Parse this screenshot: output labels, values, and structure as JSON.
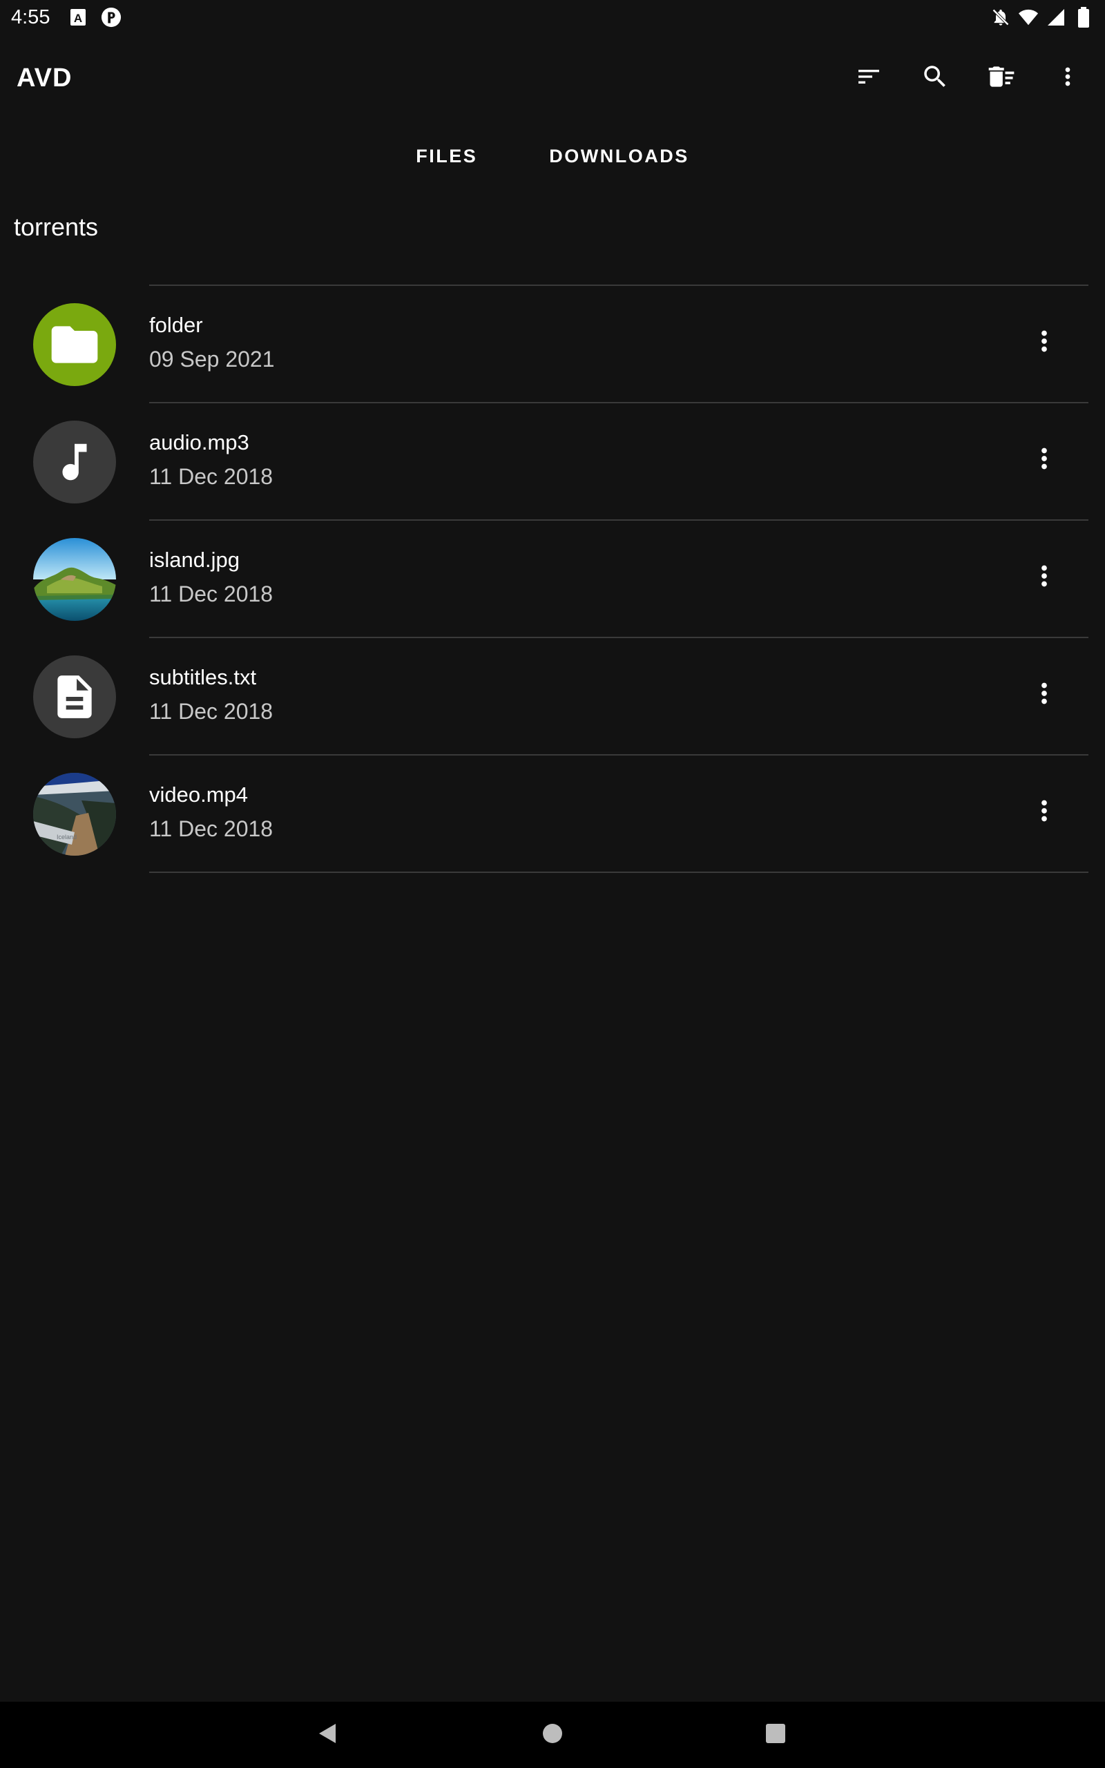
{
  "status_bar": {
    "time": "4:55",
    "icons": [
      "a-notification-icon",
      "r-notification-icon",
      "mute-icon",
      "wifi-icon",
      "signal-icon",
      "battery-icon"
    ]
  },
  "app_bar": {
    "title": "AVD",
    "actions": [
      "sort-icon",
      "search-icon",
      "delete-sweep-icon",
      "more-vert-icon"
    ]
  },
  "tabs": [
    {
      "label": "FILES"
    },
    {
      "label": "DOWNLOADS"
    }
  ],
  "path": {
    "label": "torrents"
  },
  "files": [
    {
      "name": "folder",
      "date": "09 Sep 2021",
      "icon": "folder-icon"
    },
    {
      "name": "audio.mp3",
      "date": "11 Dec 2018",
      "icon": "music-note-icon"
    },
    {
      "name": "island.jpg",
      "date": "11 Dec 2018",
      "icon": "island-thumbnail"
    },
    {
      "name": "subtitles.txt",
      "date": "11 Dec 2018",
      "icon": "document-icon"
    },
    {
      "name": "video.mp4",
      "date": "11 Dec 2018",
      "icon": "video-thumbnail"
    }
  ],
  "colors": {
    "background": "#121212",
    "folder_accent": "#7aa90f",
    "icon_circle": "#3a3a3a",
    "divider": "#3a3a3a",
    "secondary_text": "#c8c8c8",
    "nav_bar": "#000000"
  },
  "nav_bar": {
    "buttons": [
      "back-icon",
      "home-icon",
      "recents-icon"
    ]
  }
}
